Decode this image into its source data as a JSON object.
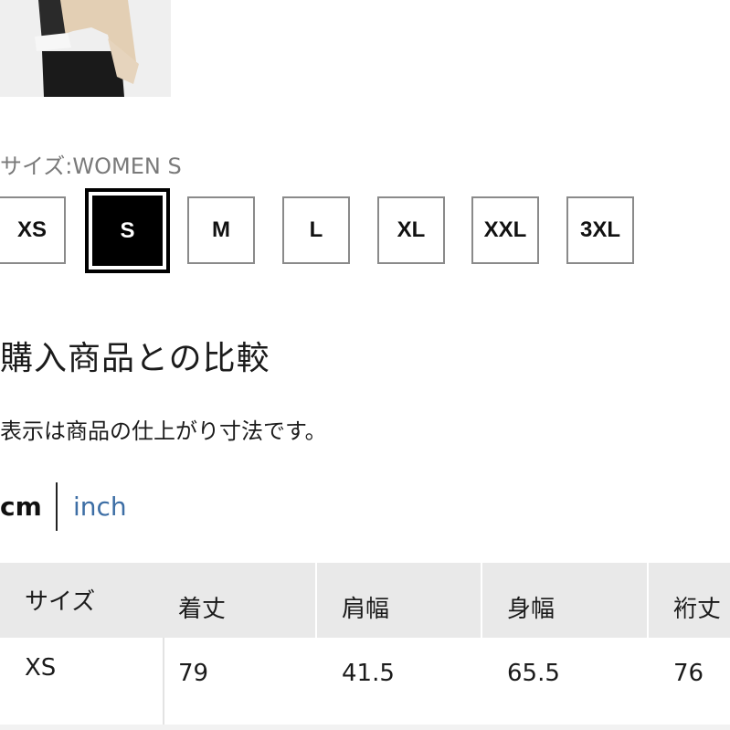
{
  "size_selector": {
    "label": "サイズ:WOMEN S",
    "options": [
      "XS",
      "S",
      "M",
      "L",
      "XL",
      "XXL",
      "3XL"
    ],
    "selected": "S"
  },
  "comparison": {
    "heading": "購入商品との比較",
    "note": "表示は商品の仕上がり寸法です。"
  },
  "units": {
    "cm": "cm",
    "inch": "inch",
    "active": "cm"
  },
  "table": {
    "headers": [
      "サイズ",
      "着丈",
      "肩幅",
      "身幅",
      "裄丈"
    ],
    "rows": [
      [
        "XS",
        "79",
        "41.5",
        "65.5",
        "76"
      ]
    ]
  },
  "colors": {
    "link": "#3d6ea5",
    "selected_bg": "#000000",
    "header_bg": "#e9e9e9"
  }
}
